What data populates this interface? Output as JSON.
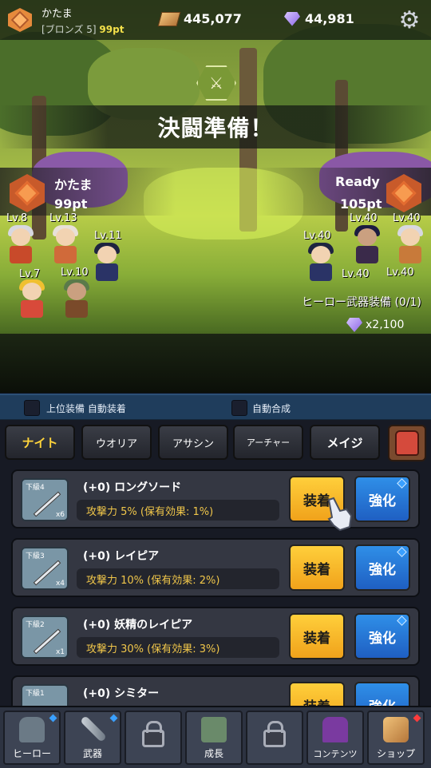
{
  "header": {
    "player_name": "かたま",
    "rank_label": "[ブロンズ 5]",
    "rank_points": "99pt",
    "gold": "445,077",
    "gems": "44,981"
  },
  "battle": {
    "title": "決闘準備！",
    "left_player": {
      "name": "かたま",
      "points": "99pt"
    },
    "right_player": {
      "name": "Ready",
      "points": "105pt"
    },
    "left_levels": [
      "Lv.8",
      "Lv.13",
      "Lv.11",
      "Lv.7",
      "Lv.10"
    ],
    "right_levels": [
      "Lv.40",
      "Lv.40",
      "Lv.40",
      "Lv.40",
      "Lv.40"
    ],
    "hero_weapon_equip": "ヒーロー武器装備 (0/1)",
    "weapon_cost": "x2,100"
  },
  "options": {
    "auto_equip_label": "上位装備 自動装着",
    "auto_merge_label": "自動合成"
  },
  "tabs": [
    "ナイト",
    "ウオリア",
    "アサシン",
    "アーチャー",
    "メイジ"
  ],
  "items": [
    {
      "grade": "下級4",
      "count": "x6",
      "name": "(+0) ロングソード",
      "stat": "攻撃力 5% (保有効果: 1%)",
      "equip": "装着",
      "upgrade": "強化"
    },
    {
      "grade": "下級3",
      "count": "x4",
      "name": "(+0) レイピア",
      "stat": "攻撃力 10% (保有効果: 2%)",
      "equip": "装着",
      "upgrade": "強化"
    },
    {
      "grade": "下級2",
      "count": "x1",
      "name": "(+0) 妖精のレイピア",
      "stat": "攻撃力 30% (保有効果: 3%)",
      "equip": "装着",
      "upgrade": "強化"
    },
    {
      "grade": "下級1",
      "count": "",
      "name": "(+0) シミター",
      "stat": "",
      "equip": "装着",
      "upgrade": "強化"
    }
  ],
  "nav": [
    "ヒーロー",
    "武器",
    "",
    "成長",
    "",
    "コンテンツ",
    "ショップ"
  ],
  "colors": {
    "accent_gold": "#ffd43b",
    "upgrade_blue": "#2f8fe8",
    "equip_yellow": "#ffcf3b"
  }
}
